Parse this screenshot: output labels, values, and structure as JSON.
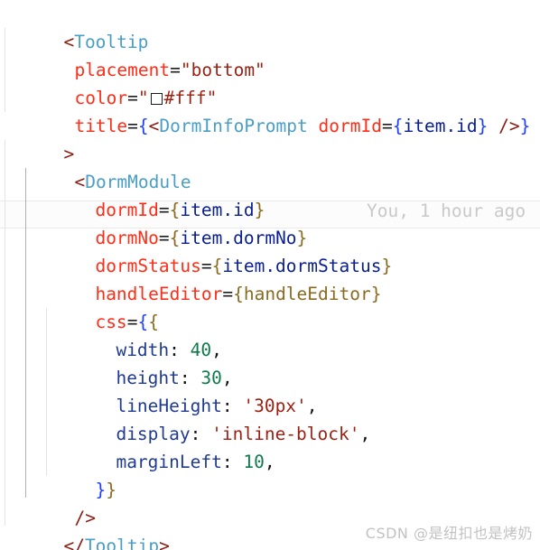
{
  "editor": {
    "language": "jsx",
    "background": "#ffffff",
    "blame_annotation": "You, 1 hour ago",
    "watermark": "CSDN @是纽扣也是烤奶",
    "colors": {
      "tag": "#4a9ec4",
      "tag_bracket": "#8b1a10",
      "attribute": "#ff2d17",
      "string": "#9c1f12",
      "brace_blue": "#1f3fff",
      "brace_olive": "#8a6a20",
      "expression": "#0a1f8f",
      "css_property": "#1f3a93",
      "number": "#0f7a4a",
      "blame_text": "#c9c9c9",
      "indent_guide": "#e4e4e4",
      "indent_guide_active": "#b0b0b0"
    },
    "color_swatch": {
      "name": "color-preview-swatch",
      "value": "#fff",
      "border": "#1a1a1a"
    }
  },
  "code": {
    "line1": {
      "lt": "<",
      "tag": "Tooltip"
    },
    "line2": {
      "attr": "placement",
      "eq": "=",
      "string": "\"bottom\""
    },
    "line3": {
      "attr": "color",
      "eq": "=",
      "quote_open": "\"",
      "value": "#fff",
      "quote_close": "\""
    },
    "line4": {
      "attr": "title",
      "eq": "=",
      "brace_open": "{",
      "lt": "<",
      "tag": "DormInfoPrompt",
      "attr2": "dormId",
      "eq2": "=",
      "brace2_open": "{",
      "expr": "item.id",
      "brace2_close": "}",
      "selfclose": "/>",
      "brace_close": "}"
    },
    "line5": {
      "gt": ">"
    },
    "line6": {
      "lt": "<",
      "tag": "DormModule"
    },
    "line7": {
      "attr": "dormId",
      "eq": "=",
      "brace_open": "{",
      "expr": "item.id",
      "brace_close": "}"
    },
    "line8": {
      "attr": "dormNo",
      "eq": "=",
      "brace_open": "{",
      "expr": "item.dormNo",
      "brace_close": "}"
    },
    "line9": {
      "attr": "dormStatus",
      "eq": "=",
      "brace_open": "{",
      "expr": "item.dormStatus",
      "brace_close": "}"
    },
    "line10": {
      "attr": "handleEditor",
      "eq": "=",
      "brace_open": "{",
      "expr": "handleEditor",
      "brace_close": "}"
    },
    "line11": {
      "attr": "css",
      "eq": "=",
      "brace_outer": "{",
      "brace_inner": "{"
    },
    "line12": {
      "prop": "width",
      "colon": ": ",
      "num": "40",
      "comma": ","
    },
    "line13": {
      "prop": "height",
      "colon": ": ",
      "num": "30",
      "comma": ","
    },
    "line14": {
      "prop": "lineHeight",
      "colon": ": ",
      "str": "'30px'",
      "comma": ","
    },
    "line15": {
      "prop": "display",
      "colon": ": ",
      "str": "'inline-block'",
      "comma": ","
    },
    "line16": {
      "prop": "marginLeft",
      "colon": ": ",
      "num": "10",
      "comma": ","
    },
    "line17": {
      "brace_inner": "}",
      "brace_outer": "}"
    },
    "line18": {
      "selfclose": "/>"
    },
    "line19": {
      "lt": "</",
      "tag": "Tooltip",
      "gt": ">"
    }
  }
}
